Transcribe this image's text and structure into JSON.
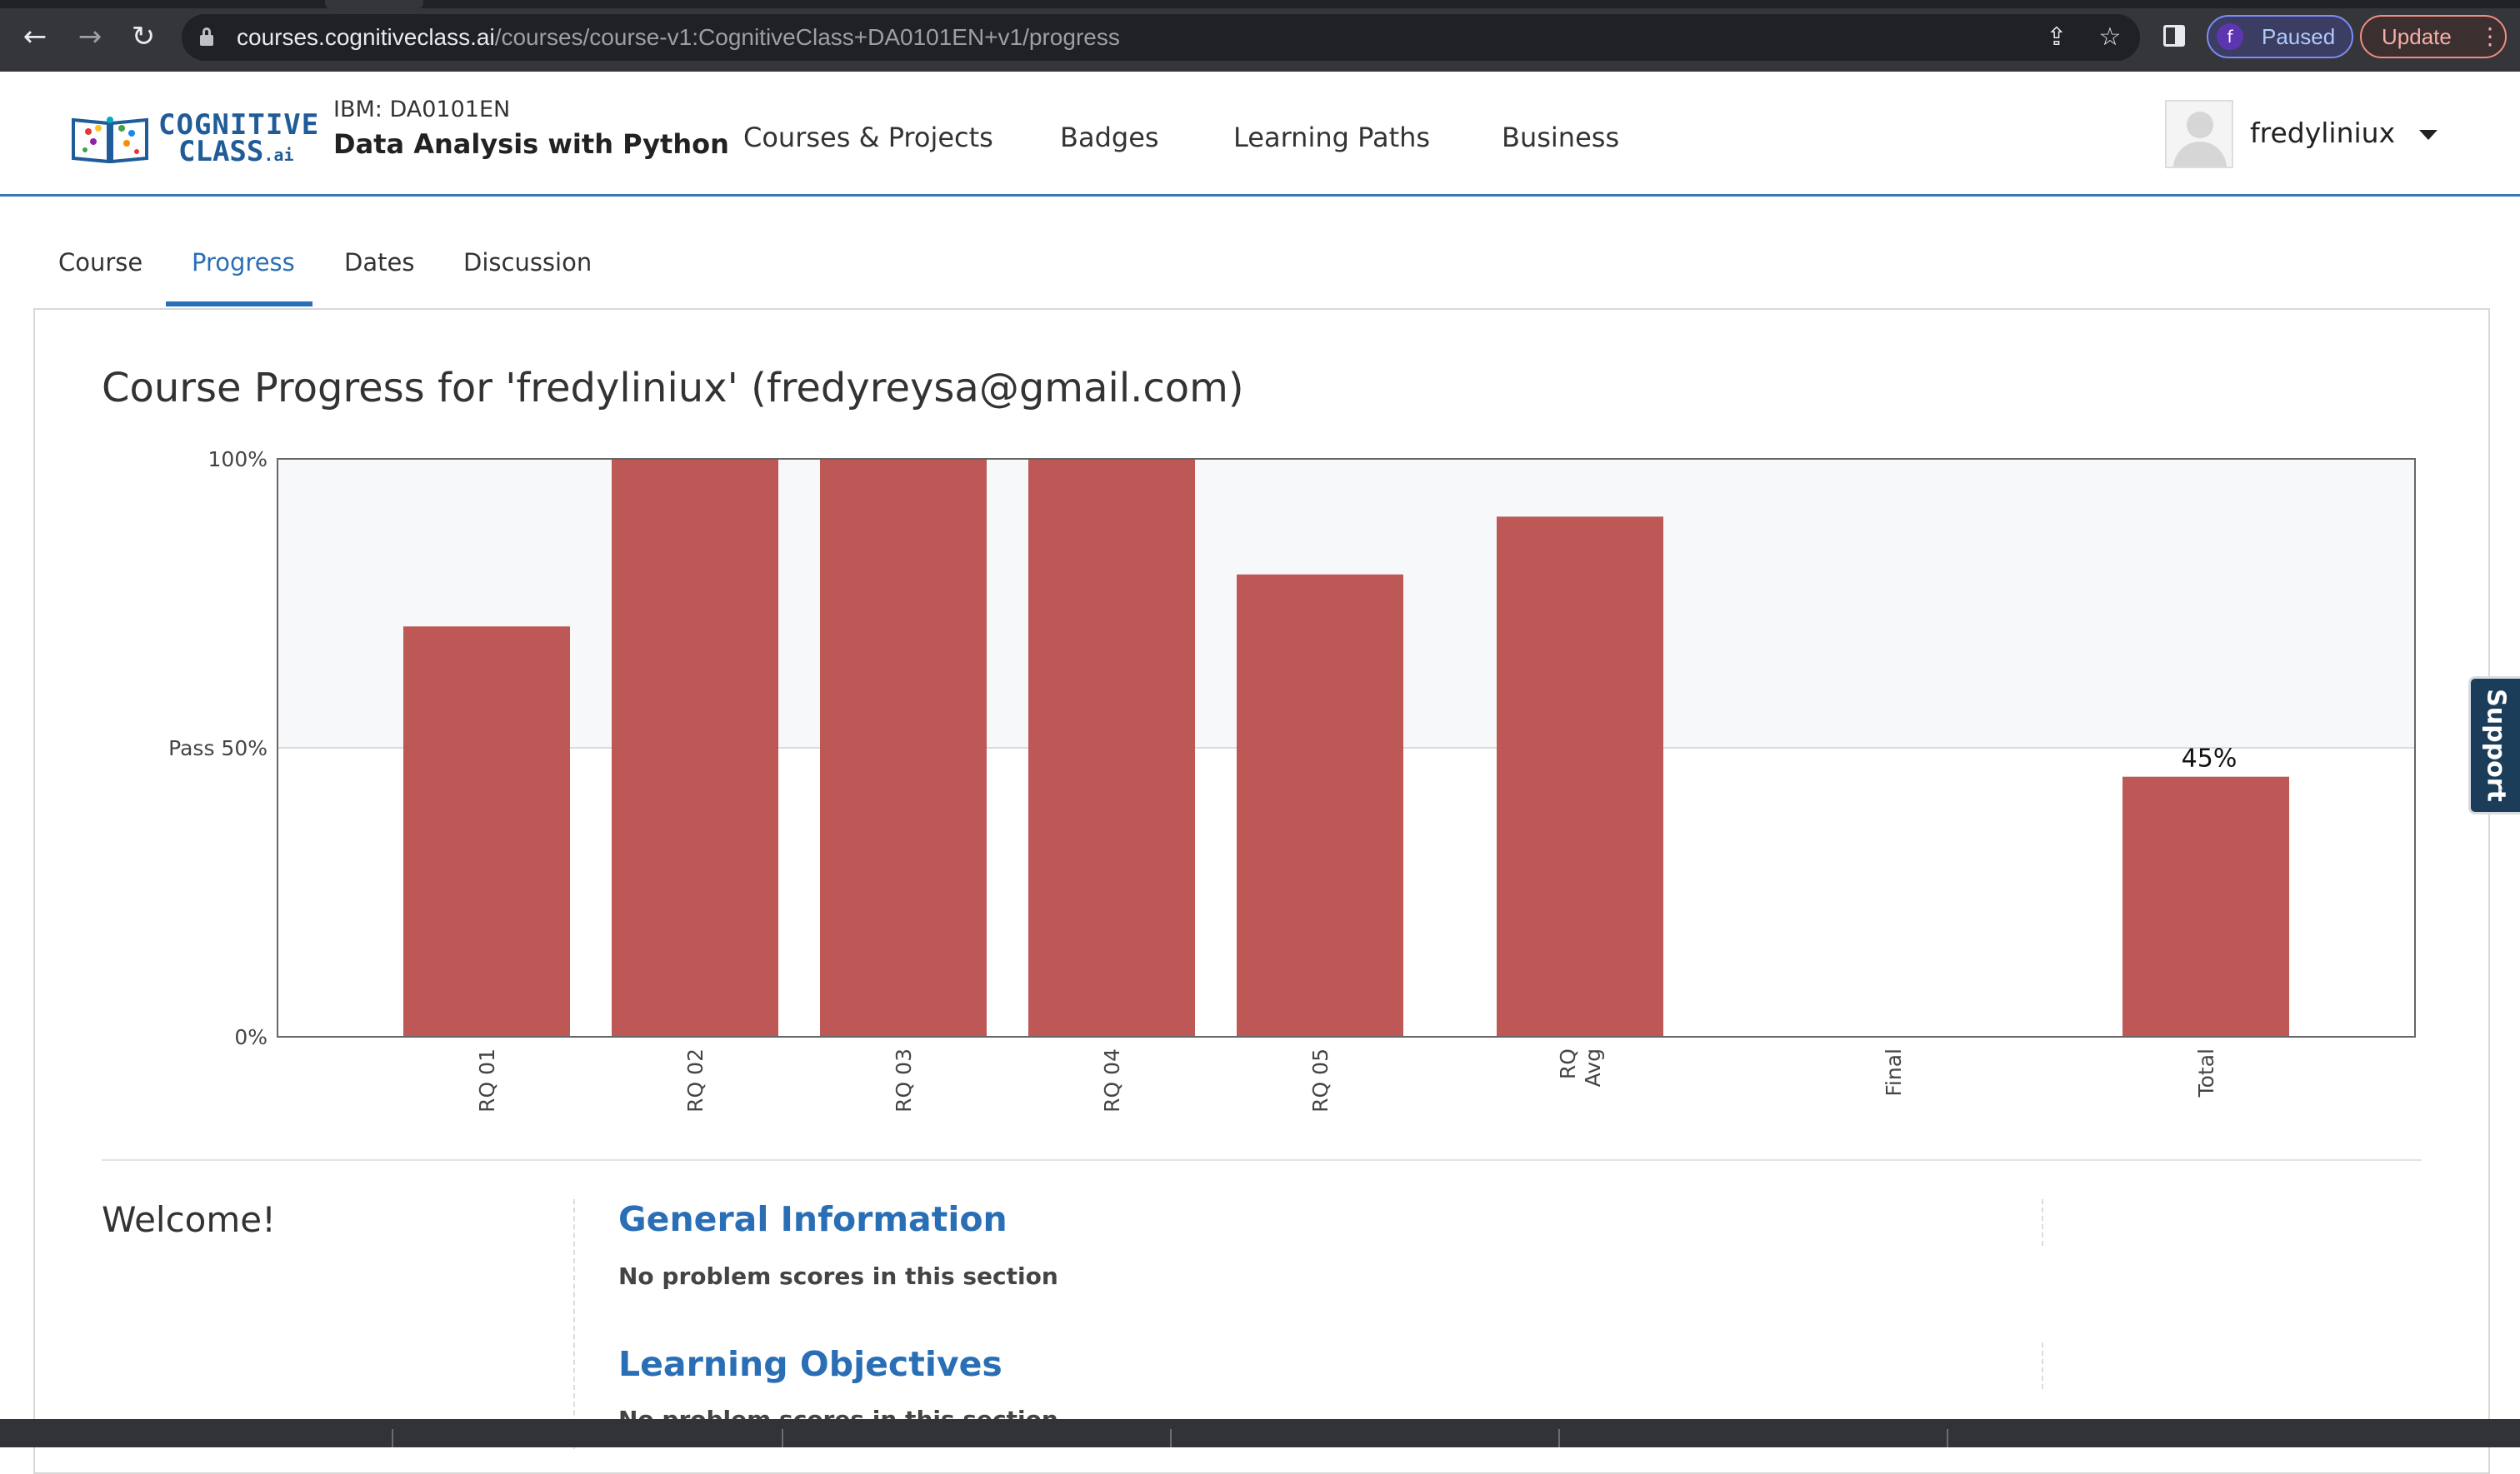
{
  "browser": {
    "url_host": "courses.cognitiveclass.ai",
    "url_path": "/courses/course-v1:CognitiveClass+DA0101EN+v1/progress",
    "profile_initial": "f",
    "profile_status": "Paused",
    "update_label": "Update",
    "icons": [
      "back-arrow-icon",
      "forward-arrow-icon",
      "reload-icon",
      "lock-icon",
      "share-icon",
      "star-icon",
      "side-panel-icon",
      "kebab-menu-icon"
    ]
  },
  "header": {
    "logo_line1": "COGNITIVE",
    "logo_line2": "CLASS",
    "logo_suffix": ".ai",
    "course_org": "IBM: DA0101EN",
    "course_name": "Data Analysis with Python",
    "nav": [
      "Courses & Projects",
      "Badges",
      "Learning Paths",
      "Business"
    ],
    "username": "fredyliniux"
  },
  "tabs": {
    "items": [
      "Course",
      "Progress",
      "Dates",
      "Discussion"
    ],
    "active": "Progress"
  },
  "page": {
    "title": "Course Progress for 'fredyliniux' (fredyreysa@gmail.com)"
  },
  "chart_data": {
    "type": "bar",
    "categories": [
      "RQ 01",
      "RQ 02",
      "RQ 03",
      "RQ 04",
      "RQ 05",
      "RQ Avg",
      "Final",
      "Total"
    ],
    "values": [
      71,
      100,
      100,
      100,
      80,
      90,
      0,
      45
    ],
    "ylim": [
      0,
      100
    ],
    "y_ticks": [
      {
        "value": 0,
        "label": "0%"
      },
      {
        "value": 50,
        "label": "Pass 50%"
      },
      {
        "value": 100,
        "label": "100%"
      }
    ],
    "data_labels": [
      {
        "category": "Total",
        "label": "45%"
      }
    ],
    "bar_color": "#b94a48",
    "above_pass_fill": "#f7f8fa",
    "grid": false,
    "legend": "none"
  },
  "sections": {
    "welcome": "Welcome!",
    "items": [
      {
        "title": "General Information",
        "note": "No problem scores in this section"
      },
      {
        "title": "Learning Objectives",
        "note": "No problem scores in this section"
      }
    ]
  },
  "support_label": "Support"
}
